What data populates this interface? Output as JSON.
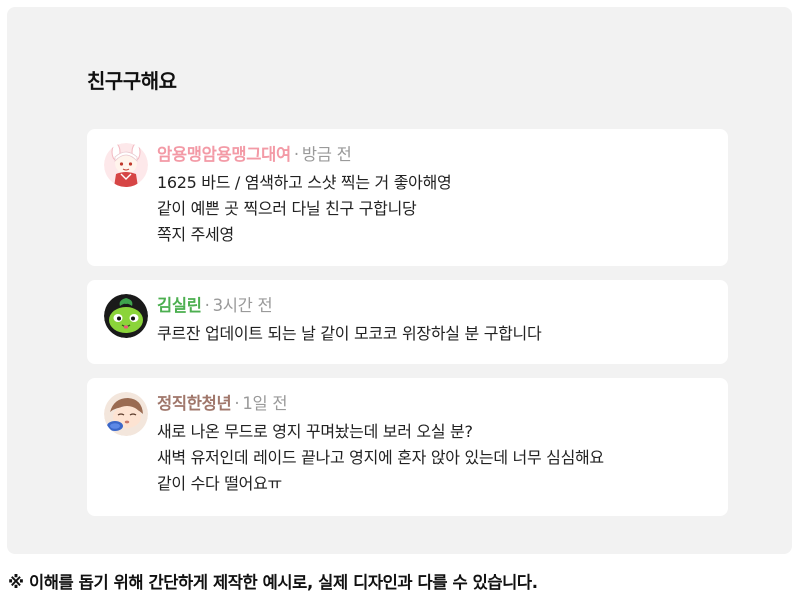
{
  "board": {
    "title": "친구구해요"
  },
  "posts": [
    {
      "author": "암용맹암용맹그대여",
      "author_color": "#f39aa6",
      "separator": "·",
      "time": "방금 전",
      "avatar_icon": "rabbit-girl-icon",
      "lines": [
        "1625 바드 / 염색하고 스샷 찍는 거 좋아해영",
        "같이 예쁜 곳 찍으러 다닐 친구 구합니당",
        "쪽지 주세영"
      ]
    },
    {
      "author": "김실린",
      "author_color": "#4caf50",
      "separator": "·",
      "time": "3시간 전",
      "avatar_icon": "green-mokoko-icon",
      "lines": [
        "쿠르잔 업데이트 되는 날 같이 모코코 위장하실 분 구합니다"
      ]
    },
    {
      "author": "정직한청년",
      "author_color": "#a0776b",
      "separator": "·",
      "time": "1일 전",
      "avatar_icon": "sleeping-character-icon",
      "lines": [
        "새로 나온 무드로 영지 꾸며놨는데 보러 오실 분?",
        "새벽 유저인데 레이드 끝나고 영지에 혼자 앉아 있는데 너무 심심해요",
        "같이 수다 떨어요ㅠ"
      ]
    }
  ],
  "footnote": "※ 이해를 돕기 위해 간단하게 제작한 예시로, 실제 디자인과 다를 수 있습니다."
}
